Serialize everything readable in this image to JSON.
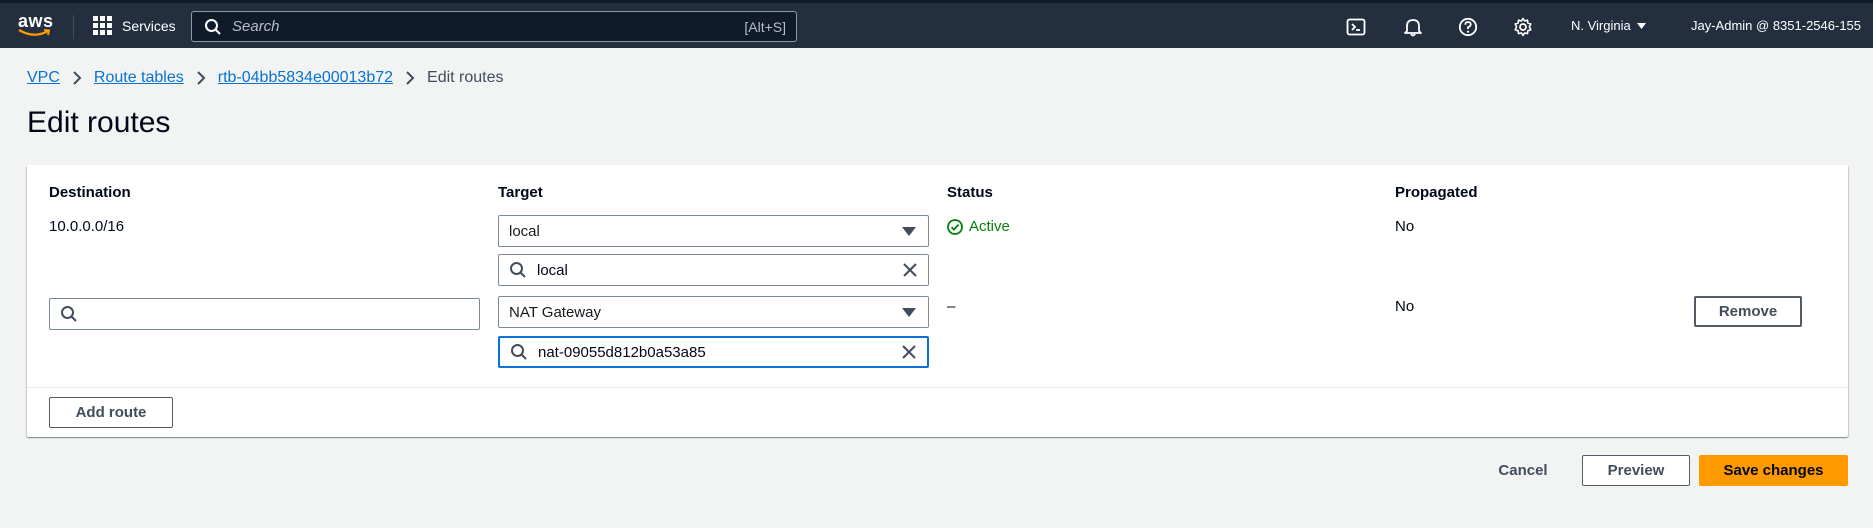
{
  "topnav": {
    "logo_text": "aws",
    "services_label": "Services",
    "search_placeholder": "Search",
    "search_shortcut": "[Alt+S]",
    "icons": [
      "cloudshell-icon",
      "bell-icon",
      "help-icon",
      "gear-icon"
    ],
    "region": "N. Virginia",
    "account": "Jay-Admin @ 8351-2546-155"
  },
  "breadcrumb": {
    "items": [
      "VPC",
      "Route tables",
      "rtb-04bb5834e00013b72"
    ],
    "current": "Edit routes"
  },
  "page_title": "Edit routes",
  "table": {
    "headers": {
      "destination": "Destination",
      "target": "Target",
      "status": "Status",
      "propagated": "Propagated"
    },
    "rows": [
      {
        "destination": "10.0.0.0/16",
        "target_type": "local",
        "target_value": "local",
        "status": "Active",
        "propagated": "No"
      },
      {
        "destination": "",
        "target_type": "NAT Gateway",
        "target_value": "nat-09055d812b0a53a85",
        "status": "–",
        "propagated": "No",
        "remove_label": "Remove"
      }
    ],
    "add_route_label": "Add route"
  },
  "footer": {
    "cancel_label": "Cancel",
    "preview_label": "Preview",
    "save_label": "Save changes"
  },
  "colors": {
    "topnav_bg": "#232f3e",
    "link": "#0972d3",
    "status_active": "#037f0c",
    "primary_button": "#ff9900"
  }
}
